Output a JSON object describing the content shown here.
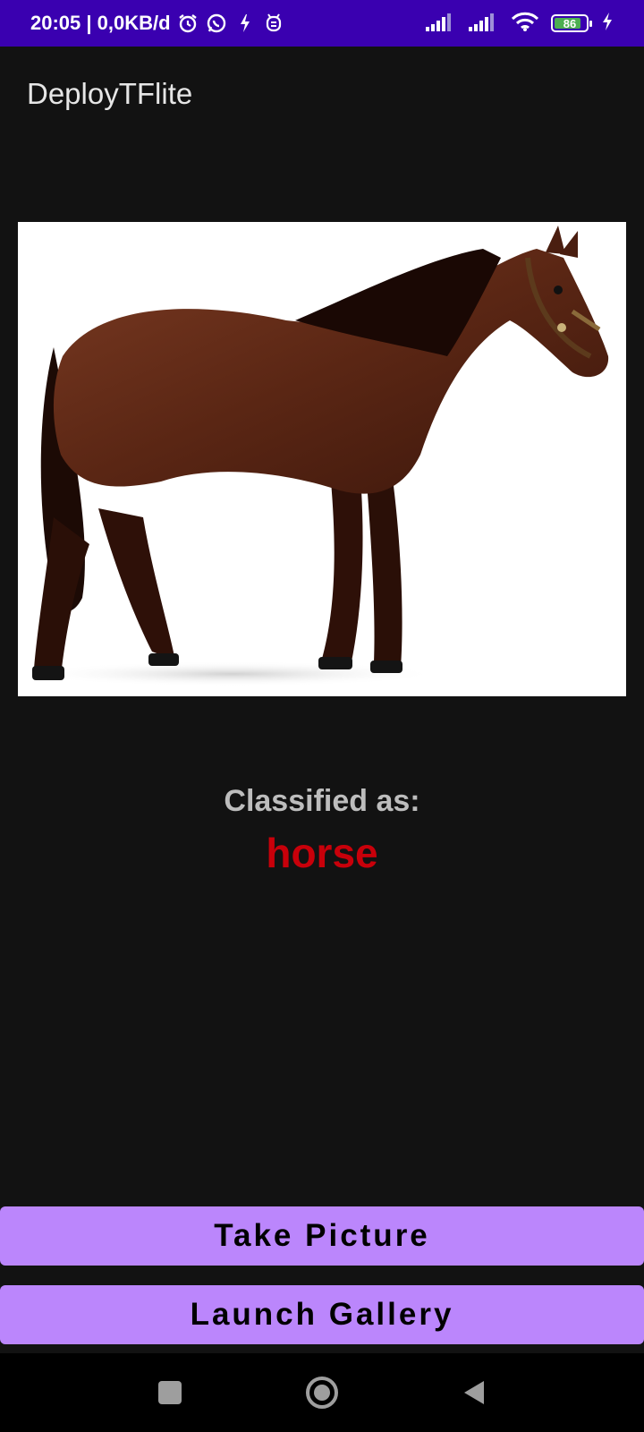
{
  "status_bar": {
    "time_and_speed": "20:05 | 0,0KB/d",
    "battery_level": "86",
    "battery_fraction": 0.86,
    "icons": [
      "alarm-icon",
      "whatsapp-icon",
      "notification-icon",
      "app-icon",
      "signal-icon",
      "signal-icon-2",
      "wifi-icon",
      "battery-icon",
      "charging-icon"
    ]
  },
  "app_bar": {
    "title": "DeployTFlite"
  },
  "result": {
    "label": "Classified as:",
    "value": "horse",
    "value_color": "#c8000a"
  },
  "buttons": {
    "take_picture": "Take Picture",
    "launch_gallery": "Launch Gallery",
    "color": "#bb86fc"
  },
  "nav_bar": {
    "icons": [
      "recent-apps-icon",
      "home-icon",
      "back-icon"
    ]
  }
}
